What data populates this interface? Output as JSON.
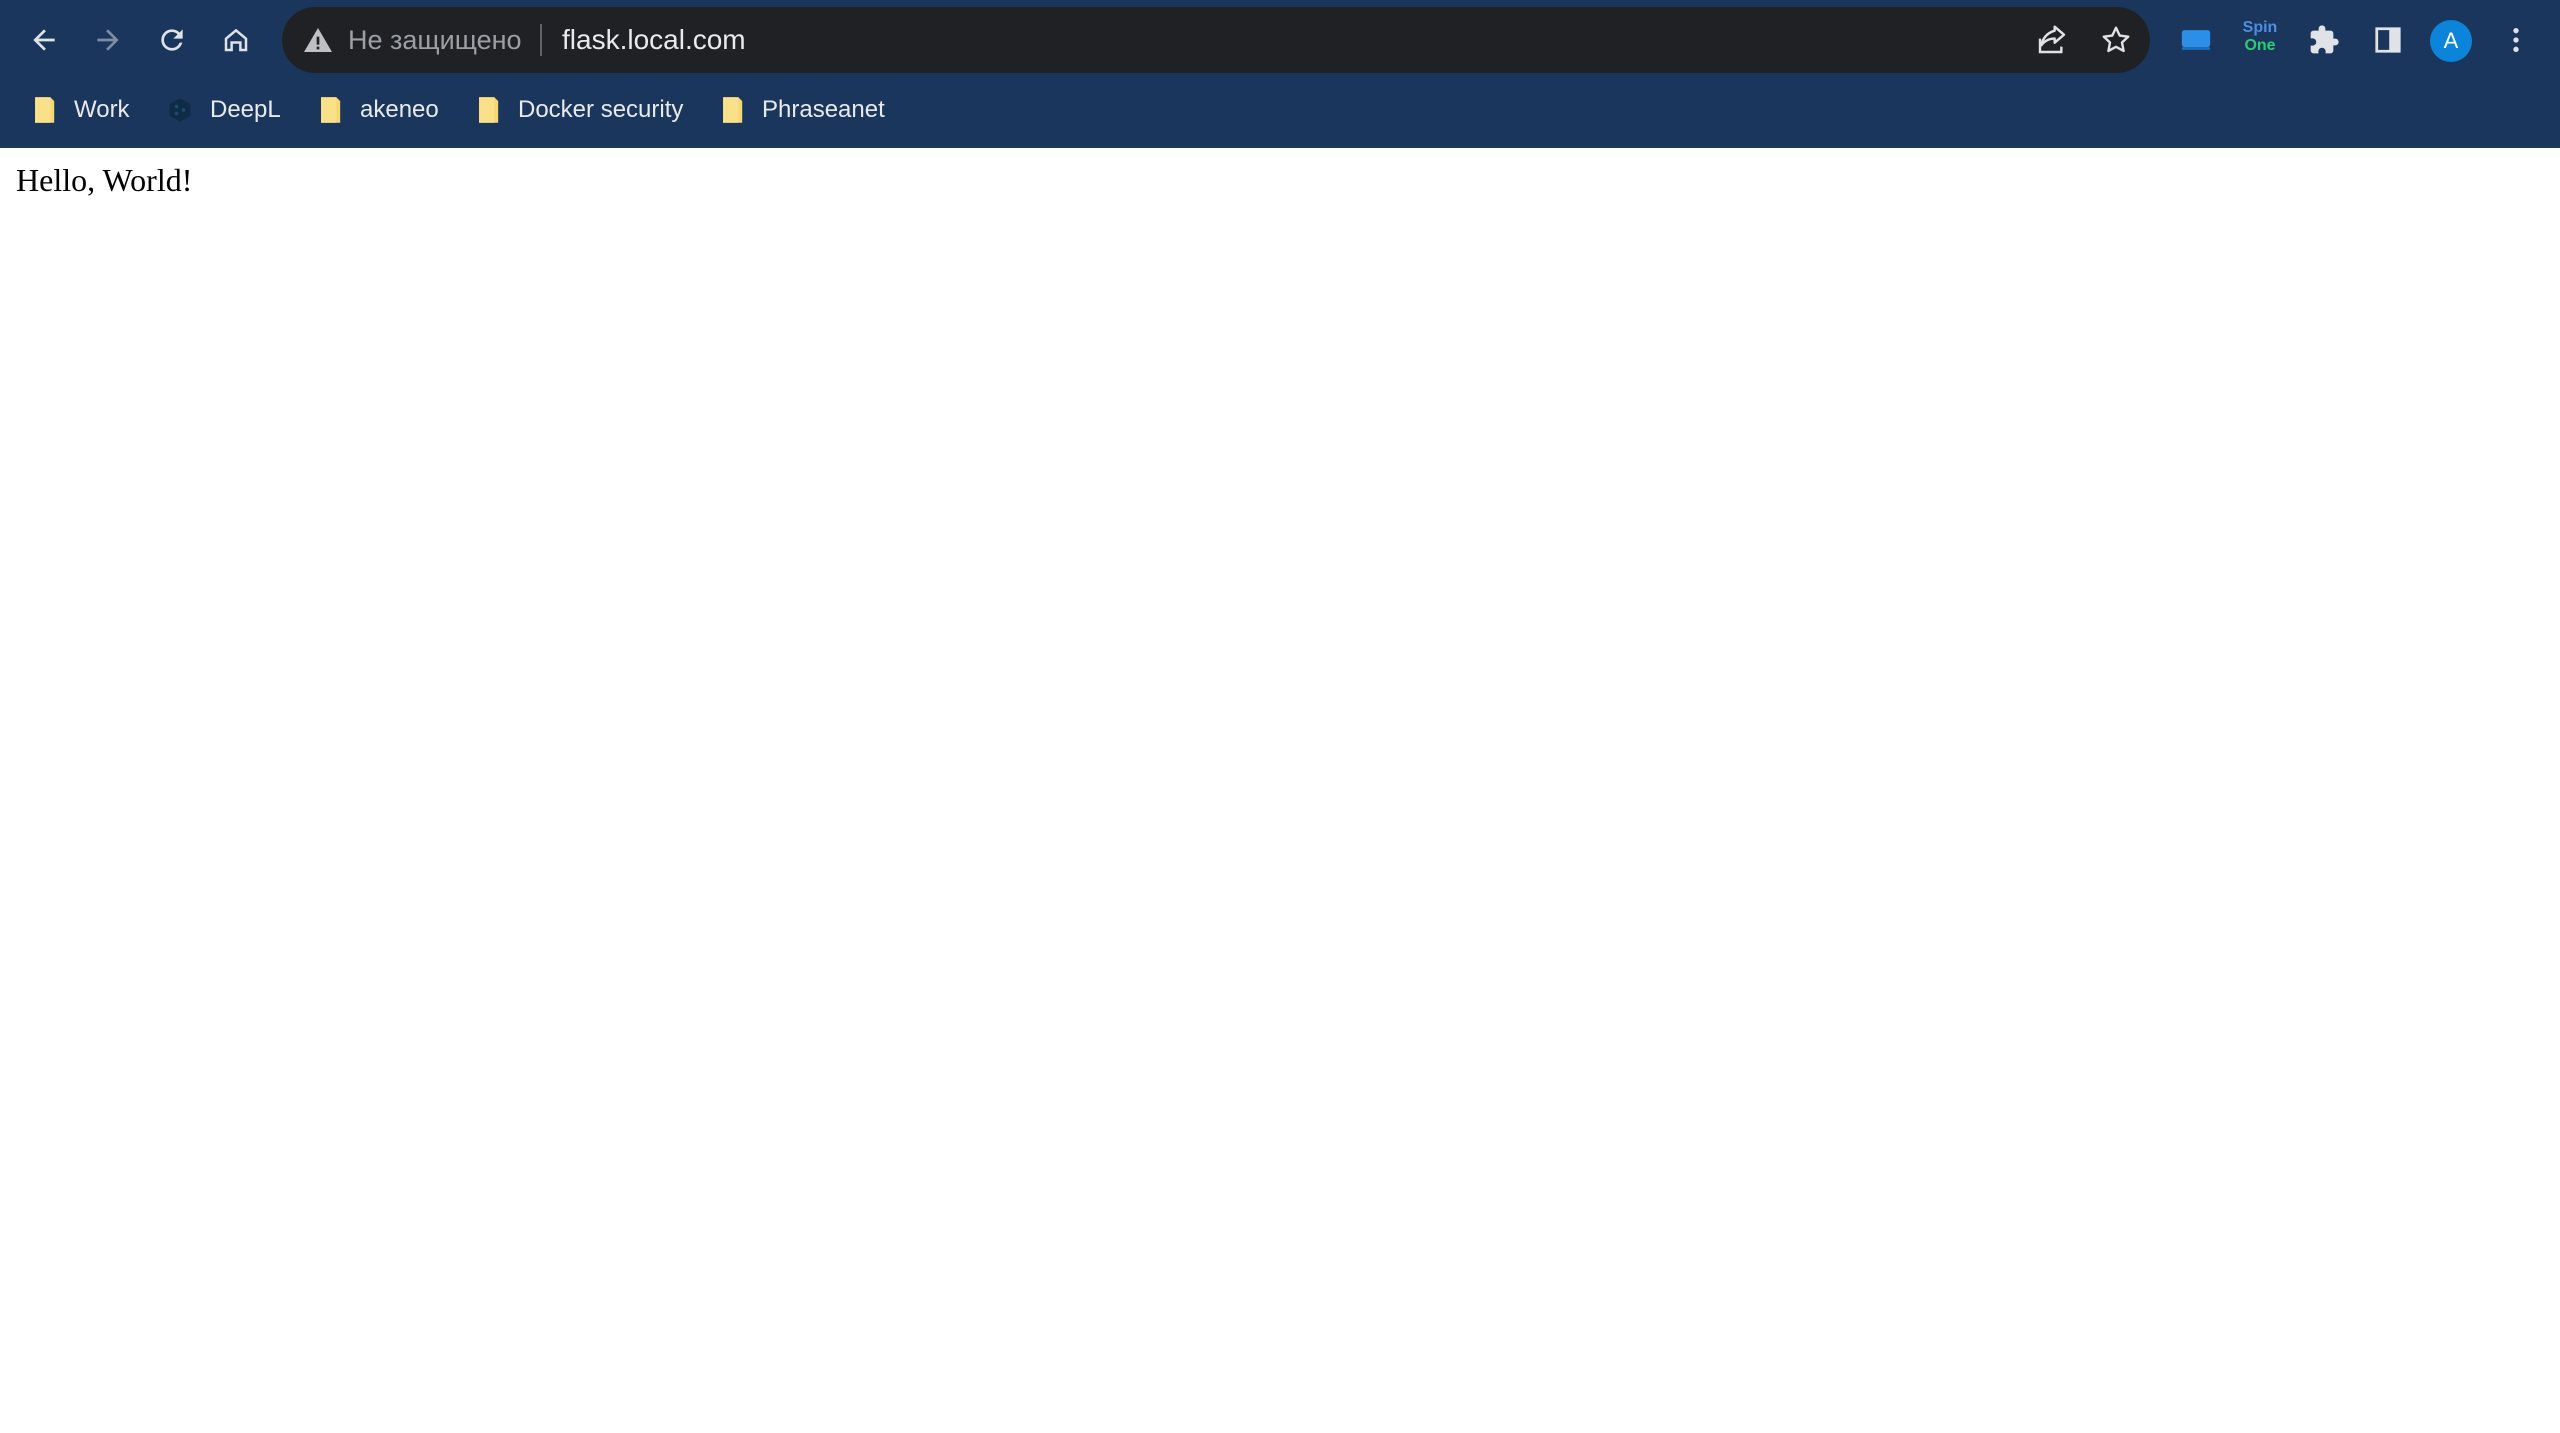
{
  "browser": {
    "colors": {
      "frame": "#1b365c",
      "omnibox": "#202124",
      "avatar": "#0b84d9"
    },
    "toolbar": {
      "back_icon": "back-arrow-icon",
      "forward_icon": "forward-arrow-icon",
      "reload_icon": "reload-icon",
      "home_icon": "home-icon"
    },
    "omnibox": {
      "security_icon": "warning-triangle-icon",
      "security_text": "Не защищено",
      "url": "flask.local.com",
      "share_icon": "share-icon",
      "bookmark_icon": "star-icon"
    },
    "extensions": {
      "cast_icon": "cast-icon",
      "spinone_line1": "Spin",
      "spinone_line2": "One",
      "puzzle_icon": "puzzle-icon",
      "side_panel_icon": "side-panel-icon",
      "avatar_letter": "A",
      "menu_icon": "more-vertical-icon"
    },
    "bookmarks": [
      {
        "label": "Work",
        "icon": "folder-icon"
      },
      {
        "label": "DeepL",
        "icon": "deepl-icon"
      },
      {
        "label": "akeneo",
        "icon": "folder-icon"
      },
      {
        "label": "Docker security",
        "icon": "folder-icon"
      },
      {
        "label": "Phraseanet",
        "icon": "folder-icon"
      }
    ]
  },
  "page": {
    "text": "Hello, World!"
  }
}
